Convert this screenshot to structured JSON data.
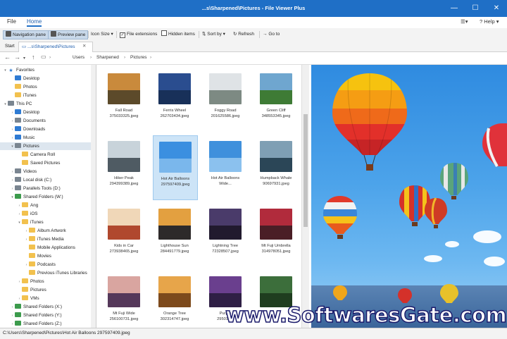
{
  "window": {
    "title": "...s\\Sharpened\\Pictures - File Viewer Plus",
    "minimize": "—",
    "maximize": "☐",
    "close": "✕"
  },
  "menu": {
    "file": "File",
    "home": "Home",
    "help": "Help"
  },
  "ribbon": {
    "navigation_pane": "Navigation pane",
    "preview_pane": "Preview pane",
    "icon_size": "Icon Size",
    "file_extensions": "File extensions",
    "hidden_items": "Hidden items",
    "sort_by": "Sort by",
    "refresh": "Refresh",
    "go_to": "Go to"
  },
  "tabs": {
    "start": "Start",
    "current": "...s\\Sharpened\\Pictures"
  },
  "breadcrumb": [
    "Users",
    "Sharpened",
    "Pictures"
  ],
  "tree": [
    {
      "label": "Favorites",
      "icon": "star"
    },
    {
      "label": "Desktop",
      "icon": "blue"
    },
    {
      "label": "Photos",
      "icon": "folder"
    },
    {
      "label": "iTunes",
      "icon": "folder"
    },
    {
      "label": "This PC",
      "icon": "gray"
    },
    {
      "label": "Desktop",
      "icon": "blue"
    },
    {
      "label": "Documents",
      "icon": "gray"
    },
    {
      "label": "Downloads",
      "icon": "blue"
    },
    {
      "label": "Music",
      "icon": "blue"
    },
    {
      "label": "Pictures",
      "icon": "gray"
    },
    {
      "label": "Camera Roll",
      "icon": "folder"
    },
    {
      "label": "Saved Pictures",
      "icon": "folder"
    },
    {
      "label": "Videos",
      "icon": "gray"
    },
    {
      "label": "Local disk (C:)",
      "icon": "gray"
    },
    {
      "label": "Parallels Tools (D:)",
      "icon": "gray"
    },
    {
      "label": "Shared Folders (W:)",
      "icon": "green"
    },
    {
      "label": "Ang",
      "icon": "folder"
    },
    {
      "label": "iOS",
      "icon": "folder"
    },
    {
      "label": "iTunes",
      "icon": "folder"
    },
    {
      "label": "Album Artwork",
      "icon": "folder"
    },
    {
      "label": "iTunes Media",
      "icon": "folder"
    },
    {
      "label": "Mobile Applications",
      "icon": "folder"
    },
    {
      "label": "Movies",
      "icon": "folder"
    },
    {
      "label": "Podcasts",
      "icon": "folder"
    },
    {
      "label": "Previous iTunes Libraries",
      "icon": "folder"
    },
    {
      "label": "Photos",
      "icon": "folder"
    },
    {
      "label": "Pictures",
      "icon": "folder"
    },
    {
      "label": "VMs",
      "icon": "folder"
    },
    {
      "label": "Shared Folders (X:)",
      "icon": "green"
    },
    {
      "label": "Shared Folders (Y:)",
      "icon": "green"
    },
    {
      "label": "Shared Folders (Z:)",
      "icon": "green"
    }
  ],
  "files": [
    {
      "name": "Fall Road",
      "sub": "375033325.jpeg",
      "sky": "#c98a3c",
      "ground": "#5c4a2a"
    },
    {
      "name": "Ferris Wheel",
      "sub": "262703434.jpeg",
      "sky": "#2a4d8f",
      "ground": "#183059"
    },
    {
      "name": "Foggy Road",
      "sub": "201625586.jpeg",
      "sky": "#dfe3e6",
      "ground": "#7d8a83"
    },
    {
      "name": "Green Cliff",
      "sub": "348553345.jpeg",
      "sky": "#6fa6cf",
      "ground": "#3e7b35"
    },
    {
      "name": "Hiker Peak",
      "sub": "294399389.jpeg",
      "sky": "#c8d3da",
      "ground": "#4f5b63"
    },
    {
      "name": "Hot Air Balloons",
      "sub": "297597409.jpeg",
      "sky": "#3b8fe0",
      "ground": "#7ab7ec"
    },
    {
      "name": "Hot Air Balloons",
      "sub": "Wide...",
      "sky": "#3f90dc",
      "ground": "#8bc1ee"
    },
    {
      "name": "Humpback Whale",
      "sub": "90697931.jpeg",
      "sky": "#7f9fb4",
      "ground": "#2b4657"
    },
    {
      "name": "Kids in Car",
      "sub": "273938465.jpeg",
      "sky": "#f0d7b8",
      "ground": "#b0482e"
    },
    {
      "name": "Lighthouse Sun",
      "sub": "284491779.jpeg",
      "sky": "#e3a040",
      "ground": "#2d2a2a"
    },
    {
      "name": "Lightning Tree",
      "sub": "72328507.jpeg",
      "sky": "#4a3b6a",
      "ground": "#211a2e"
    },
    {
      "name": "Mt Fuji Umbrella",
      "sub": "314978051.jpeg",
      "sky": "#b12b3c",
      "ground": "#4a1e26"
    },
    {
      "name": "Mt Fuji Wide",
      "sub": "256100731.jpeg",
      "sky": "#d9a5a0",
      "ground": "#55385a"
    },
    {
      "name": "Orange Tree",
      "sub": "302314747.jpeg",
      "sky": "#e7a54a",
      "ground": "#7d4a1c"
    },
    {
      "name": "Purple",
      "sub": "295014...",
      "sky": "#6a3f8e",
      "ground": "#2f1f45"
    },
    {
      "name": "",
      "sub": "",
      "sky": "#3c6e3b",
      "ground": "#1f3d1f"
    }
  ],
  "watermark": "www.SoftwaresGate.com",
  "status": "C:\\Users\\Sharpened\\Pictures\\Hot Air Balloons 297597409.jpeg"
}
